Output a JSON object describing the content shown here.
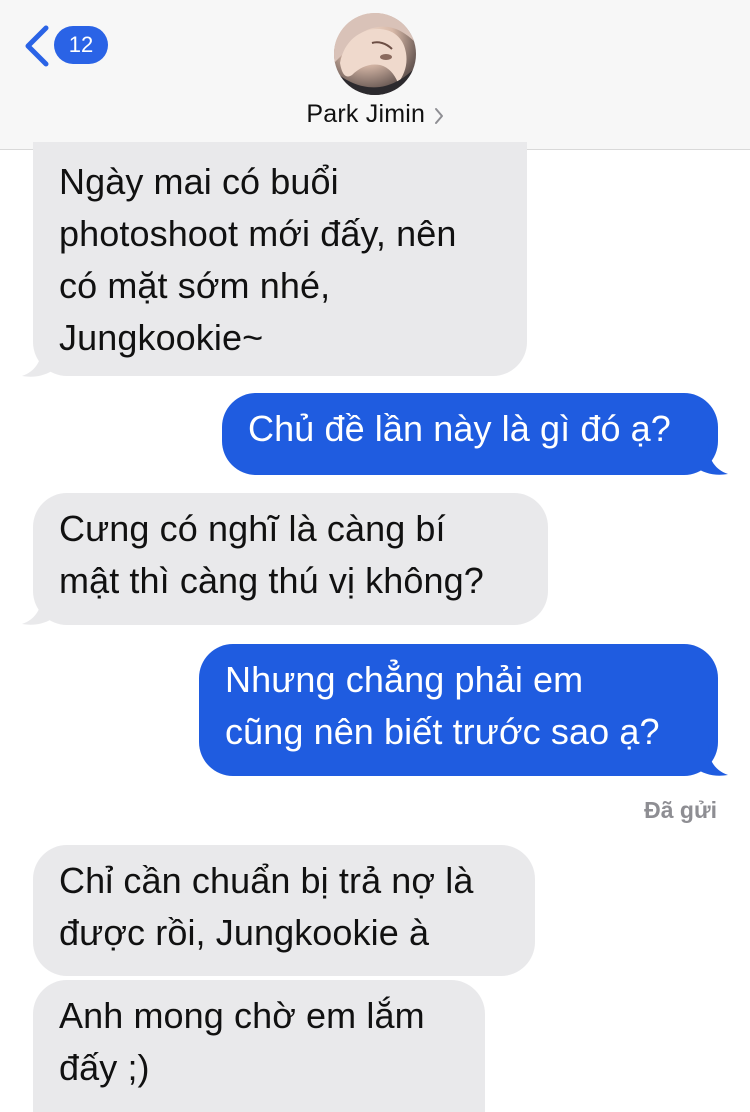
{
  "header": {
    "back_badge_count": "12",
    "contact_name": "Park Jimin"
  },
  "messages": [
    {
      "direction": "incoming",
      "lines": [
        "Ngày mai có buổi",
        "photoshoot mới đấy, nên",
        "có mặt sớm nhé,",
        "Jungkookie~"
      ]
    },
    {
      "direction": "outgoing",
      "lines": [
        "Chủ đề lần này là gì đó ạ?"
      ]
    },
    {
      "direction": "incoming",
      "lines": [
        "Cưng có nghĩ là càng bí",
        "mật thì càng thú vị không?"
      ]
    },
    {
      "direction": "outgoing",
      "lines": [
        "Nhưng chẳng phải em",
        "cũng nên biết trước sao ạ?"
      ]
    },
    {
      "direction": "incoming",
      "lines": [
        "Chỉ cần chuẩn bị trả nợ là",
        "được rồi, Jungkookie à"
      ]
    },
    {
      "direction": "incoming",
      "lines": [
        "Anh mong chờ em lắm",
        "đấy ;)"
      ]
    }
  ],
  "status_label": "Đã gửi",
  "colors": {
    "incoming_bubble": "#e9e9eb",
    "outgoing_bubble": "#1f5ce0",
    "accent": "#2a63e6"
  }
}
